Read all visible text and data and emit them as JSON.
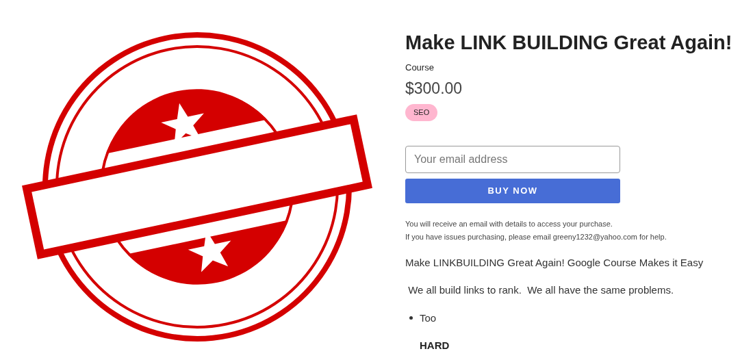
{
  "product": {
    "title": "Make LINK BUILDING Great Again!",
    "type": "Course",
    "price": "$300.00",
    "tags": [
      {
        "label": "SEO",
        "color": "#ffb6cf"
      }
    ]
  },
  "purchase": {
    "email_placeholder": "Your email address",
    "button": "BUY NOW",
    "notes": [
      "You will receive an email with details to access your purchase.",
      "If you have issues purchasing, please email greeny1232@yahoo.com for help."
    ]
  },
  "description": {
    "paragraphs": [
      "Make LINKBUILDING Great Again! Google Course Makes it Easy",
      " We all build links to rank.  We all have the same problems."
    ],
    "list": [
      {
        "text": "Too",
        "subtext": "HARD"
      }
    ]
  }
}
